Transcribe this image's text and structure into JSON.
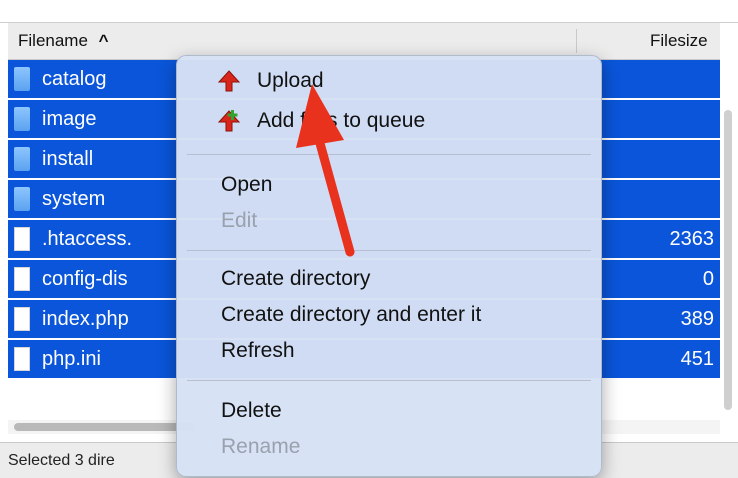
{
  "header": {
    "filename_label": "Filename",
    "sort_indicator": "^",
    "filesize_label": "Filesize"
  },
  "rows": [
    {
      "name": "catalog",
      "size": "",
      "icon": "folder-icon"
    },
    {
      "name": "image",
      "size": "",
      "icon": "folder-icon"
    },
    {
      "name": "install",
      "size": "",
      "icon": "folder-icon"
    },
    {
      "name": "system",
      "size": "",
      "icon": "folder-icon"
    },
    {
      "name": ".htaccess.",
      "size": "2363",
      "icon": "file-icon"
    },
    {
      "name": "config-dis",
      "size": "0",
      "icon": "file-icon"
    },
    {
      "name": "index.php",
      "size": "389",
      "icon": "file-icon"
    },
    {
      "name": "php.ini",
      "size": "451",
      "icon": "file-icon"
    }
  ],
  "status": {
    "text": "Selected 3 dire"
  },
  "menu": {
    "upload": "Upload",
    "add_files": "Add files to queue",
    "open": "Open",
    "edit": "Edit",
    "create_directory": "Create directory",
    "create_directory_enter": "Create directory and enter it",
    "refresh": "Refresh",
    "delete": "Delete",
    "rename": "Rename"
  },
  "colors": {
    "selection": "#0a55d9",
    "menu_bg": "#d6e1f4",
    "arrow": "#e8321e"
  }
}
